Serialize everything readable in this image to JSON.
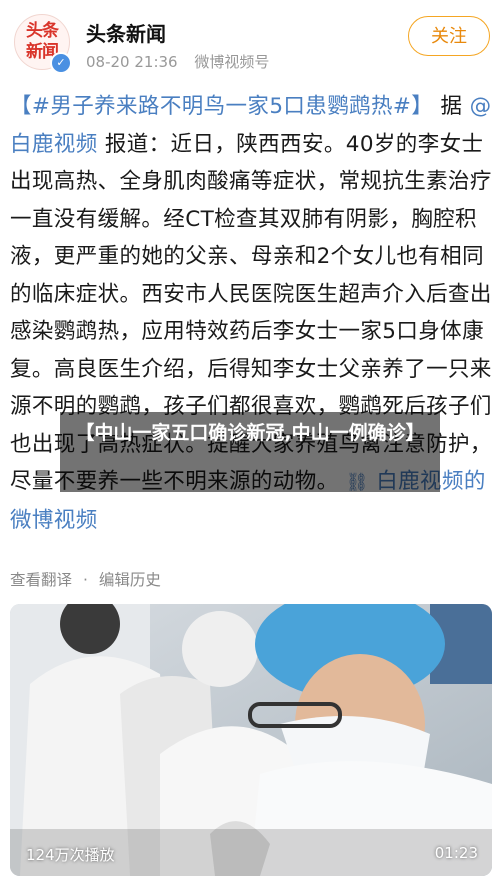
{
  "header": {
    "avatar_text": "头条新闻",
    "source_name": "头条新闻",
    "date": "08-20 21:36",
    "via": "微博视频号",
    "follow_label": "关注"
  },
  "post": {
    "hashtag": "【#男子养来路不明鸟一家5口患鹦鹉热#】",
    "seg1": "据",
    "mention": "@白鹿视频",
    "seg2": "报道：近日，陕西西安。40岁的李女士出现高热、全身肌肉酸痛等症状，常规抗生素治疗一直没有缓解。经CT检查其双肺有阴影，胸腔积液，更严重的她的父亲、母亲和2个女儿也有相同的临床症状。西安市人民医院医生超声介入后查出感染鹦鹉热，应用特效药后李女士一家5口身体康复。高良医生介绍，后得知李女士父亲养了一只来源不明的鹦鹉，孩子们都很喜欢，鹦鹉死后孩子们也出现了高热症状。提醒大家养殖鸟禽注意防护，尽量不要养一些不明来源的动物。",
    "video_link": "白鹿视频的微博视频"
  },
  "footer": {
    "translate": "查看翻译",
    "separator": "·",
    "edit_history": "编辑历史"
  },
  "video": {
    "views": "124万次播放",
    "duration": "01:23"
  },
  "overlay": {
    "text": "【中山一家五口确诊新冠,中山一例确诊】"
  }
}
